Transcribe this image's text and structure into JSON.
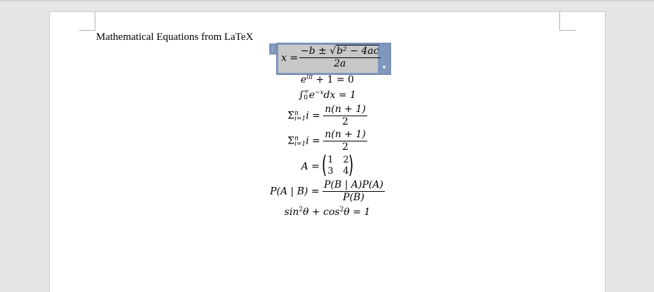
{
  "document": {
    "title": "Mathematical Equations from LaTeX"
  },
  "equation_box": {
    "handle_icon": "⋮",
    "dropdown_icon": "▾"
  },
  "equations": {
    "quadratic": {
      "lhs": "x =",
      "num_pre": "−b ± √",
      "num_rad": "b² − 4ac",
      "den": "2a"
    },
    "euler": {
      "base": "e",
      "exp": "iπ",
      "rest": " + 1 = 0"
    },
    "integral": {
      "sym": "∫",
      "upper": "∞",
      "lower": "0",
      "base": "e",
      "exp": "−x",
      "rest": "dx = 1"
    },
    "sum1": {
      "sym": "Σ",
      "upper": "n",
      "lower": "i=1",
      "var": "i =",
      "num": "n(n + 1)",
      "den": "2"
    },
    "sum2": {
      "sym": "Σ",
      "upper": "n",
      "lower": "i=1",
      "var": "i =",
      "num": "n(n + 1)",
      "den": "2"
    },
    "matrix": {
      "lhs": "A =",
      "a11": "1",
      "a12": "2",
      "a21": "3",
      "a22": "4"
    },
    "bayes": {
      "lhs": "P(A | B) =",
      "num": "P(B | A)P(A)",
      "den": "P(B)"
    },
    "trig": {
      "sin": "sin",
      "exp1": "2",
      "theta1": "θ + ",
      "cos": "cos",
      "exp2": "2",
      "rest": "θ = 1"
    }
  }
}
